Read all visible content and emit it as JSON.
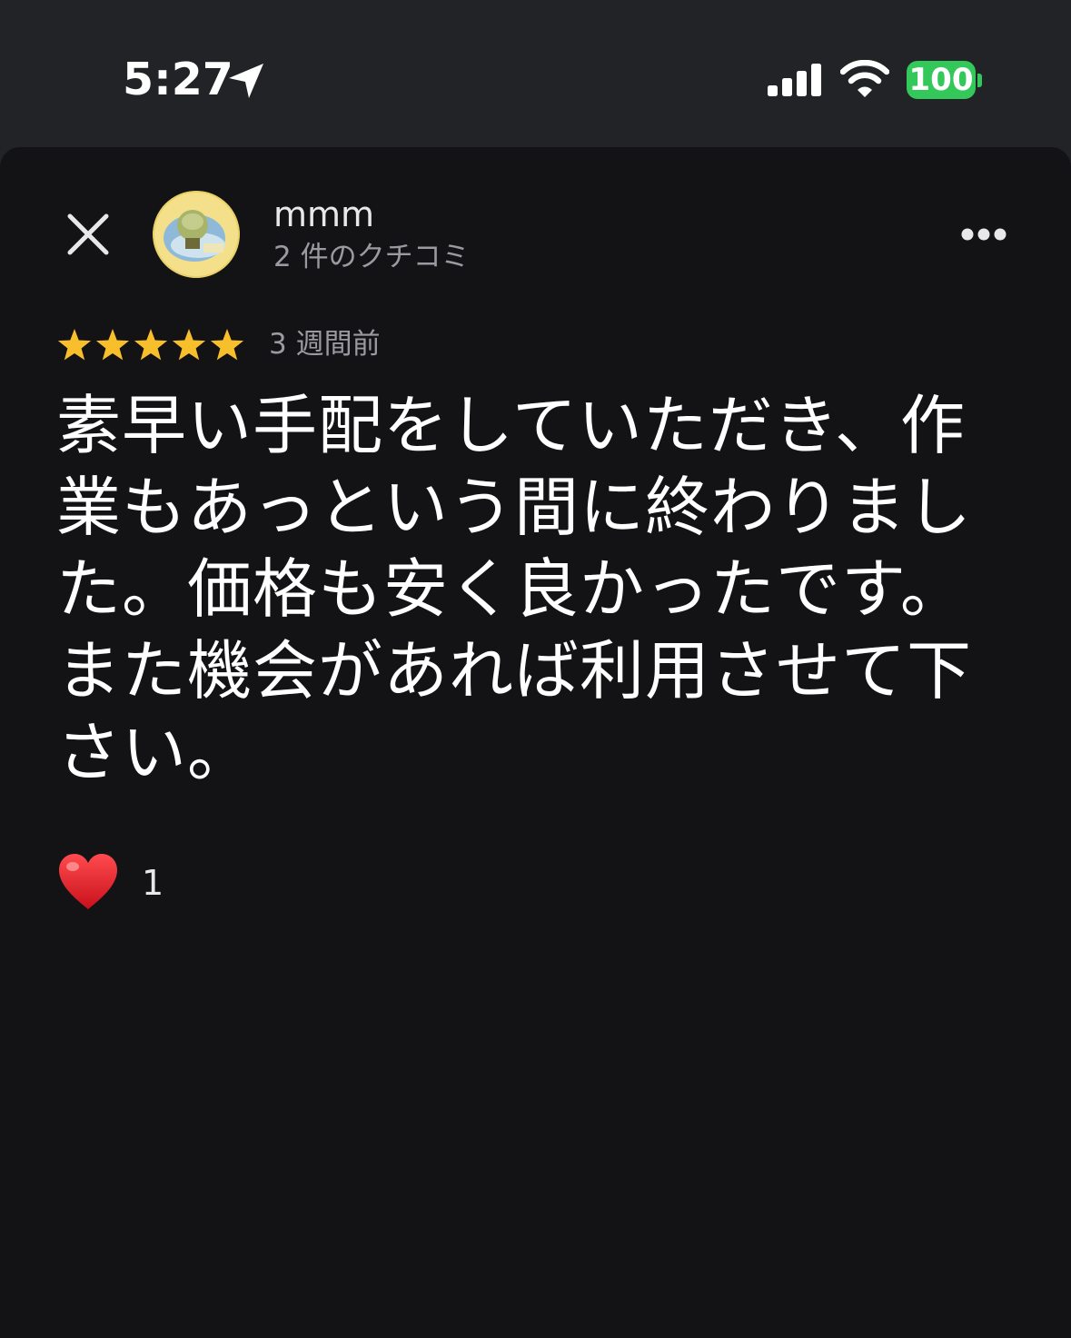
{
  "status_bar": {
    "time": "5:27",
    "battery": "100",
    "icons": [
      "location-arrow-icon",
      "cellular-signal-icon",
      "wifi-icon",
      "battery-icon"
    ]
  },
  "header": {
    "close_icon": "close-icon",
    "avatar_icon": "avatar",
    "user_name": "mmm",
    "review_count": "2 件のクチコミ",
    "more_icon": "more-icon"
  },
  "review": {
    "rating": 5,
    "rating_max": 5,
    "time_ago": "3 週間前",
    "text": "素早い手配をしていただき、作業もあっという間に終わりました。価格も安く良かったです。また機会があれば利用させて下さい。"
  },
  "reactions": {
    "heart_icon": "heart-icon",
    "count": "1"
  },
  "colors": {
    "background": "#131316",
    "status_bar": "#222327",
    "star": "#f7bf2b",
    "battery": "#34c759",
    "secondary_text": "#9a9aa0",
    "heart": "#e0151f"
  }
}
